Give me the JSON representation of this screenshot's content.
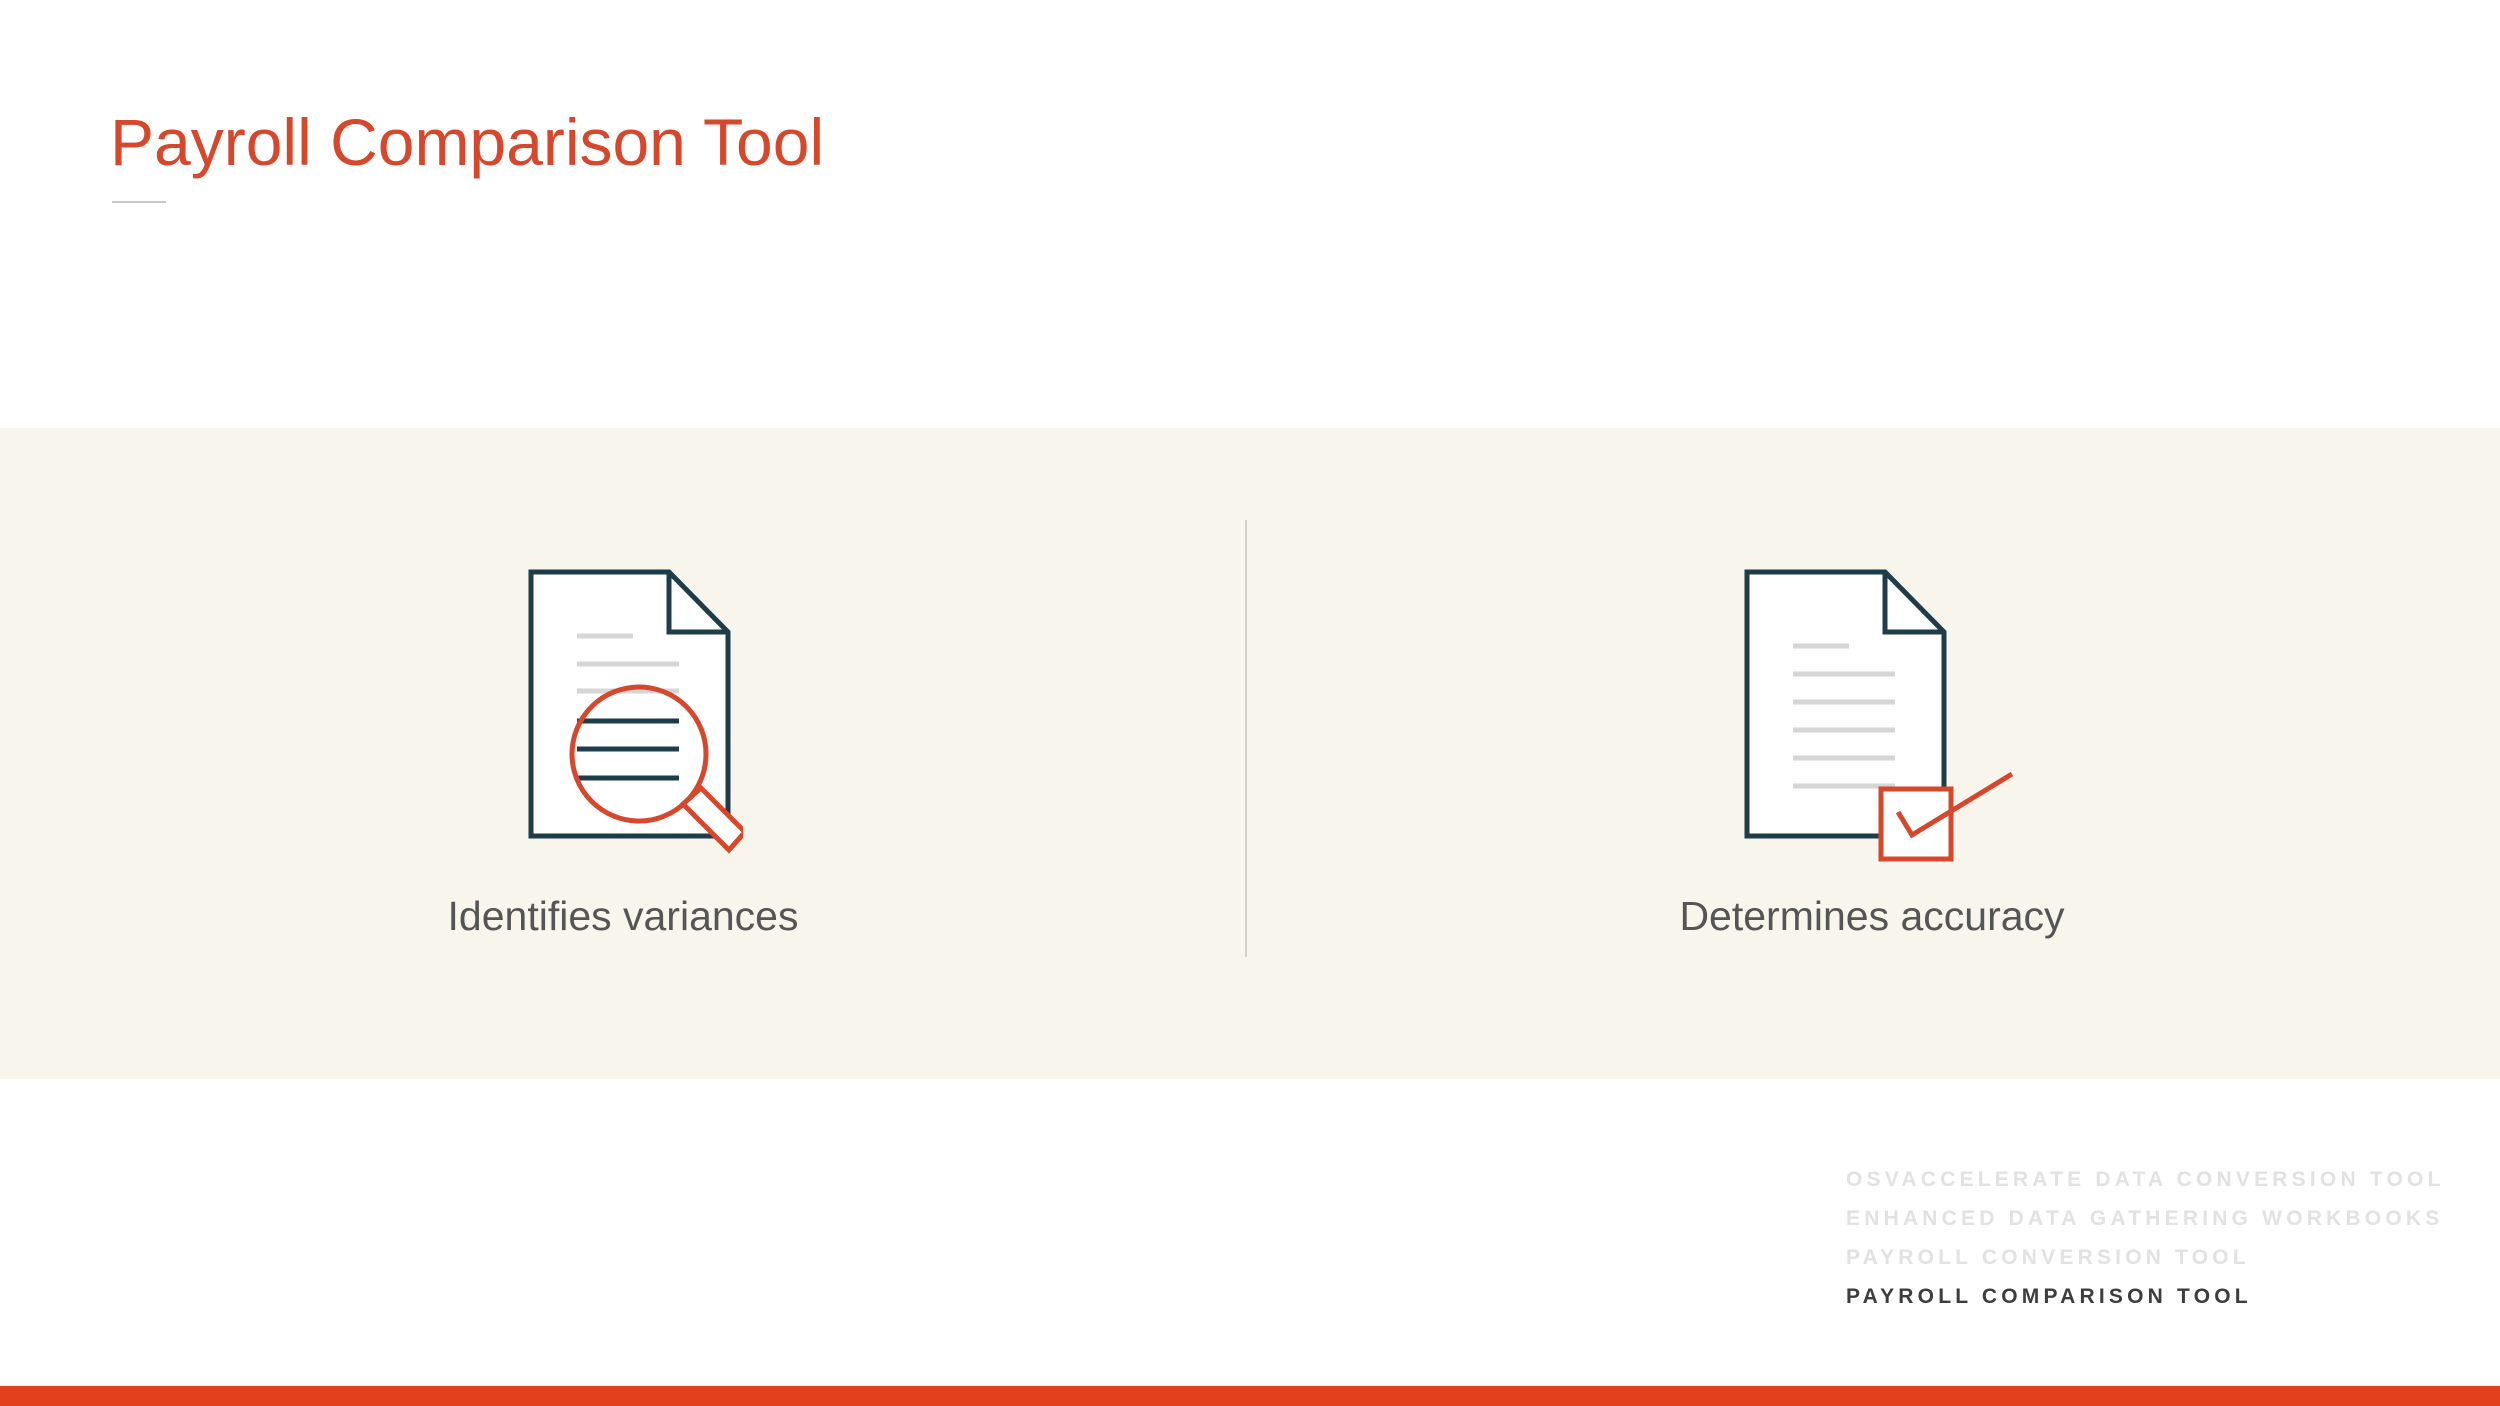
{
  "slide": {
    "title": "Payroll Comparison Tool"
  },
  "features": [
    {
      "label": "Identifies variances",
      "icon": "document-magnifier-icon"
    },
    {
      "label": "Determines accuracy",
      "icon": "document-checkbox-icon"
    }
  ],
  "nav": {
    "items": [
      {
        "label": "OSVACCELERATE DATA CONVERSION TOOL",
        "active": false
      },
      {
        "label": "ENHANCED DATA GATHERING WORKBOOKS",
        "active": false
      },
      {
        "label": "PAYROLL CONVERSION TOOL",
        "active": false
      },
      {
        "label": "PAYROLL COMPARISON TOOL",
        "active": true
      }
    ]
  },
  "colors": {
    "accent": "#d6472b",
    "bottom_bar": "#e3401d",
    "band": "#f8f5ec",
    "icon_outline": "#1f3c4a",
    "nav_inactive": "#e2e2e2",
    "nav_active": "#3d3d3d"
  }
}
